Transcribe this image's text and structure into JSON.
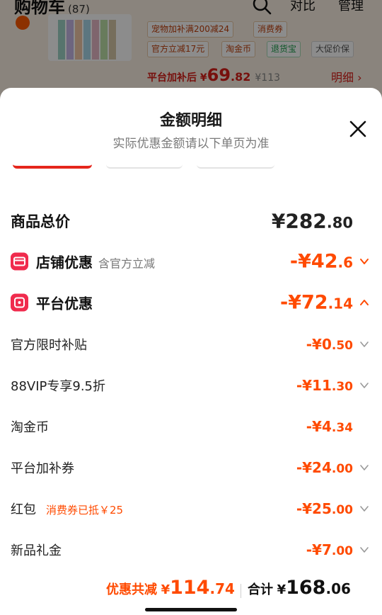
{
  "background": {
    "cart_title": "购物车",
    "cart_count": "(87)",
    "compare_label": "对比",
    "manage_label": "管理",
    "tags": [
      "宠物加补满200减24",
      "消费券",
      "官方立减17元",
      "淘金币",
      "退货宝",
      "大促价保"
    ],
    "price_prefix": "平台加补后",
    "price_currency": "¥",
    "price_int": "69",
    "price_dec": ".82",
    "price_original": "¥113",
    "detail_link": "明细"
  },
  "sheet": {
    "title": "金额明细",
    "subtitle": "实际优惠金额请以下单页为准",
    "total": {
      "label": "商品总价",
      "currency": "¥",
      "int": "282",
      "dec": ".80"
    },
    "store": {
      "label": "店铺优惠",
      "note": "含官方立减",
      "prefix": "-¥",
      "int": "42",
      "dec": ".6",
      "expanded": false
    },
    "platform": {
      "label": "平台优惠",
      "prefix": "-¥",
      "int": "72",
      "dec": ".14",
      "expanded": true
    },
    "items": [
      {
        "label": "官方限时补贴",
        "note": "",
        "prefix": "-¥",
        "int": "0",
        "dec": ".50",
        "chevron": true
      },
      {
        "label": "88VIP专享9.5折",
        "note": "",
        "prefix": "-¥",
        "int": "11",
        "dec": ".30",
        "chevron": true
      },
      {
        "label": "淘金币",
        "note": "",
        "prefix": "-¥",
        "int": "4",
        "dec": ".34",
        "chevron": false
      },
      {
        "label": "平台加补券",
        "note": "",
        "prefix": "-¥",
        "int": "24",
        "dec": ".00",
        "chevron": true
      },
      {
        "label": "红包",
        "note": "消费券已抵￥25",
        "prefix": "-¥",
        "int": "25",
        "dec": ".00",
        "chevron": true
      },
      {
        "label": "新品礼金",
        "note": "",
        "prefix": "-¥",
        "int": "7",
        "dec": ".00",
        "chevron": true
      }
    ]
  },
  "footer": {
    "discount_label": "优惠共减",
    "discount_currency": "¥",
    "discount_int": "114",
    "discount_dec": ".74",
    "total_label": "合计",
    "total_currency": "¥",
    "total_int": "168",
    "total_dec": ".06"
  },
  "colors": {
    "accent": "#ff4a00",
    "price_red": "#d91e18",
    "icon_pink": "#f02b4d"
  }
}
